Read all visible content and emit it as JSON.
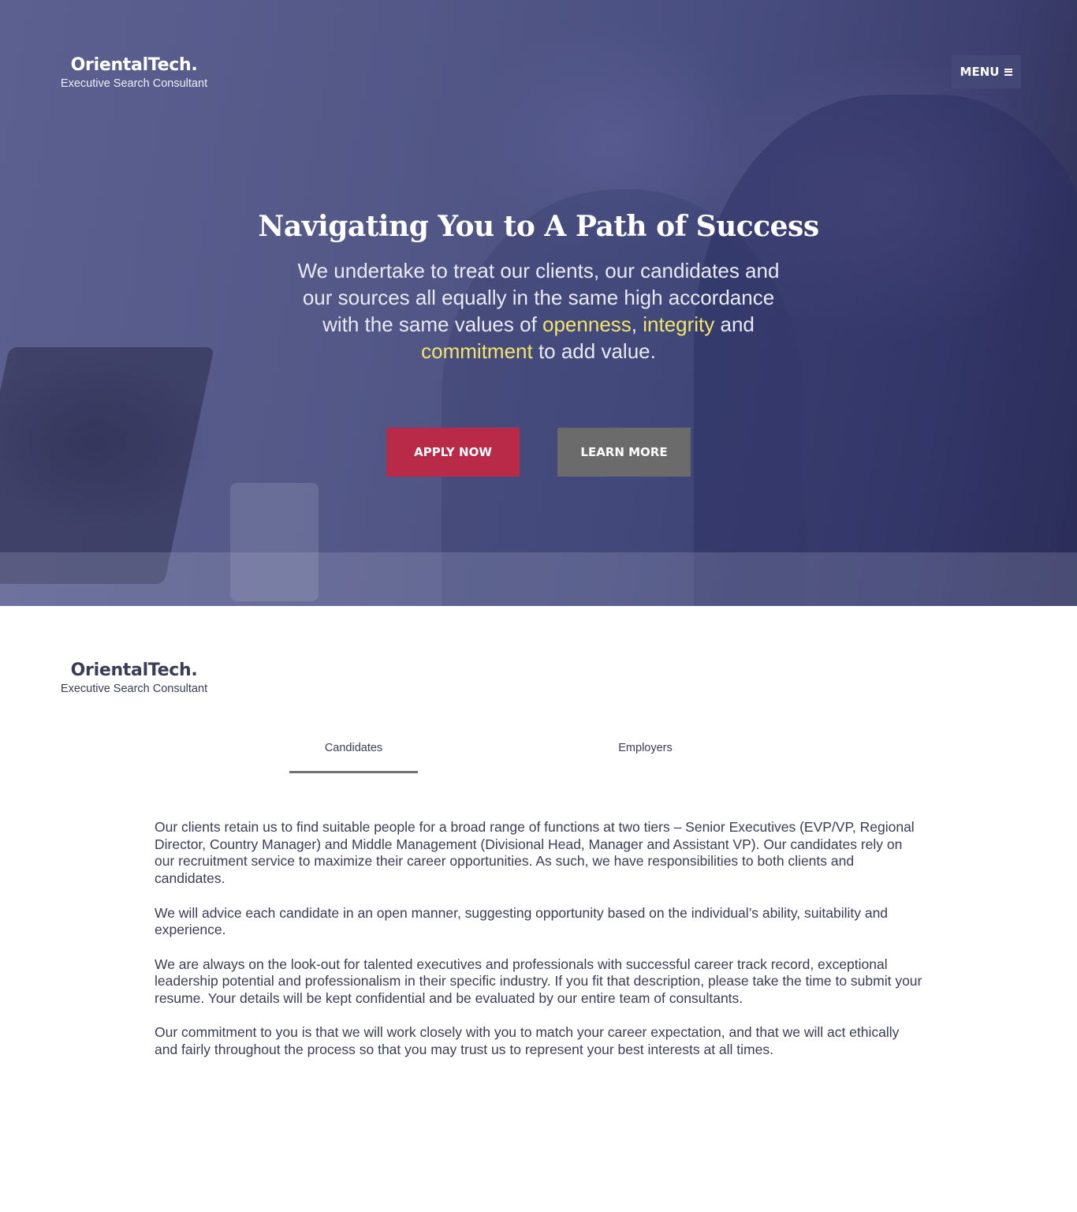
{
  "header": {
    "brand_name": "OrientalTech.",
    "brand_tagline": "Executive Search Consultant",
    "menu_label": "MENU"
  },
  "hero": {
    "title": "Navigating You to A Path of Success",
    "text_part1": "We undertake to treat our clients, our candidates and our sources all equally in the same high accordance with the same values of ",
    "highlight1": "openness",
    "sep1": ", ",
    "highlight2": "integrity",
    "sep2": " and ",
    "highlight3": "commitment",
    "text_part2": " to add value.",
    "apply_label": "APPLY NOW",
    "learn_label": "LEARN MORE",
    "highlight_color": "#f2e56b",
    "apply_color": "#b82a47",
    "learn_color": "#6b6b6b"
  },
  "section": {
    "brand_name": "OrientalTech.",
    "brand_tagline": "Executive Search Consultant",
    "tabs": [
      {
        "label": "Candidates",
        "active": true
      },
      {
        "label": "Employers",
        "active": false
      }
    ],
    "paragraphs": [
      "Our clients retain us to find suitable people for a broad range of functions at two tiers – Senior Executives (EVP/VP, Regional Director, Country Manager) and Middle Management (Divisional Head, Manager and Assistant VP).  Our candidates rely on our recruitment service to maximize their career opportunities. As such, we have responsibilities to both clients and candidates.",
      "We will advice each candidate in an open manner, suggesting opportunity based on the individual’s ability, suitability and experience.",
      "We are always on the look-out for talented executives and professionals with successful career track record, exceptional leadership potential and professionalism in their specific industry. If you fit that description, please take the time to submit your resume. Your details will be kept confidential and be evaluated by our entire team of consultants.",
      "Our commitment to you is that we will work closely with you to match your career expectation, and that we will act ethically and fairly throughout the process so that you may trust us to represent your best interests at all times."
    ]
  }
}
